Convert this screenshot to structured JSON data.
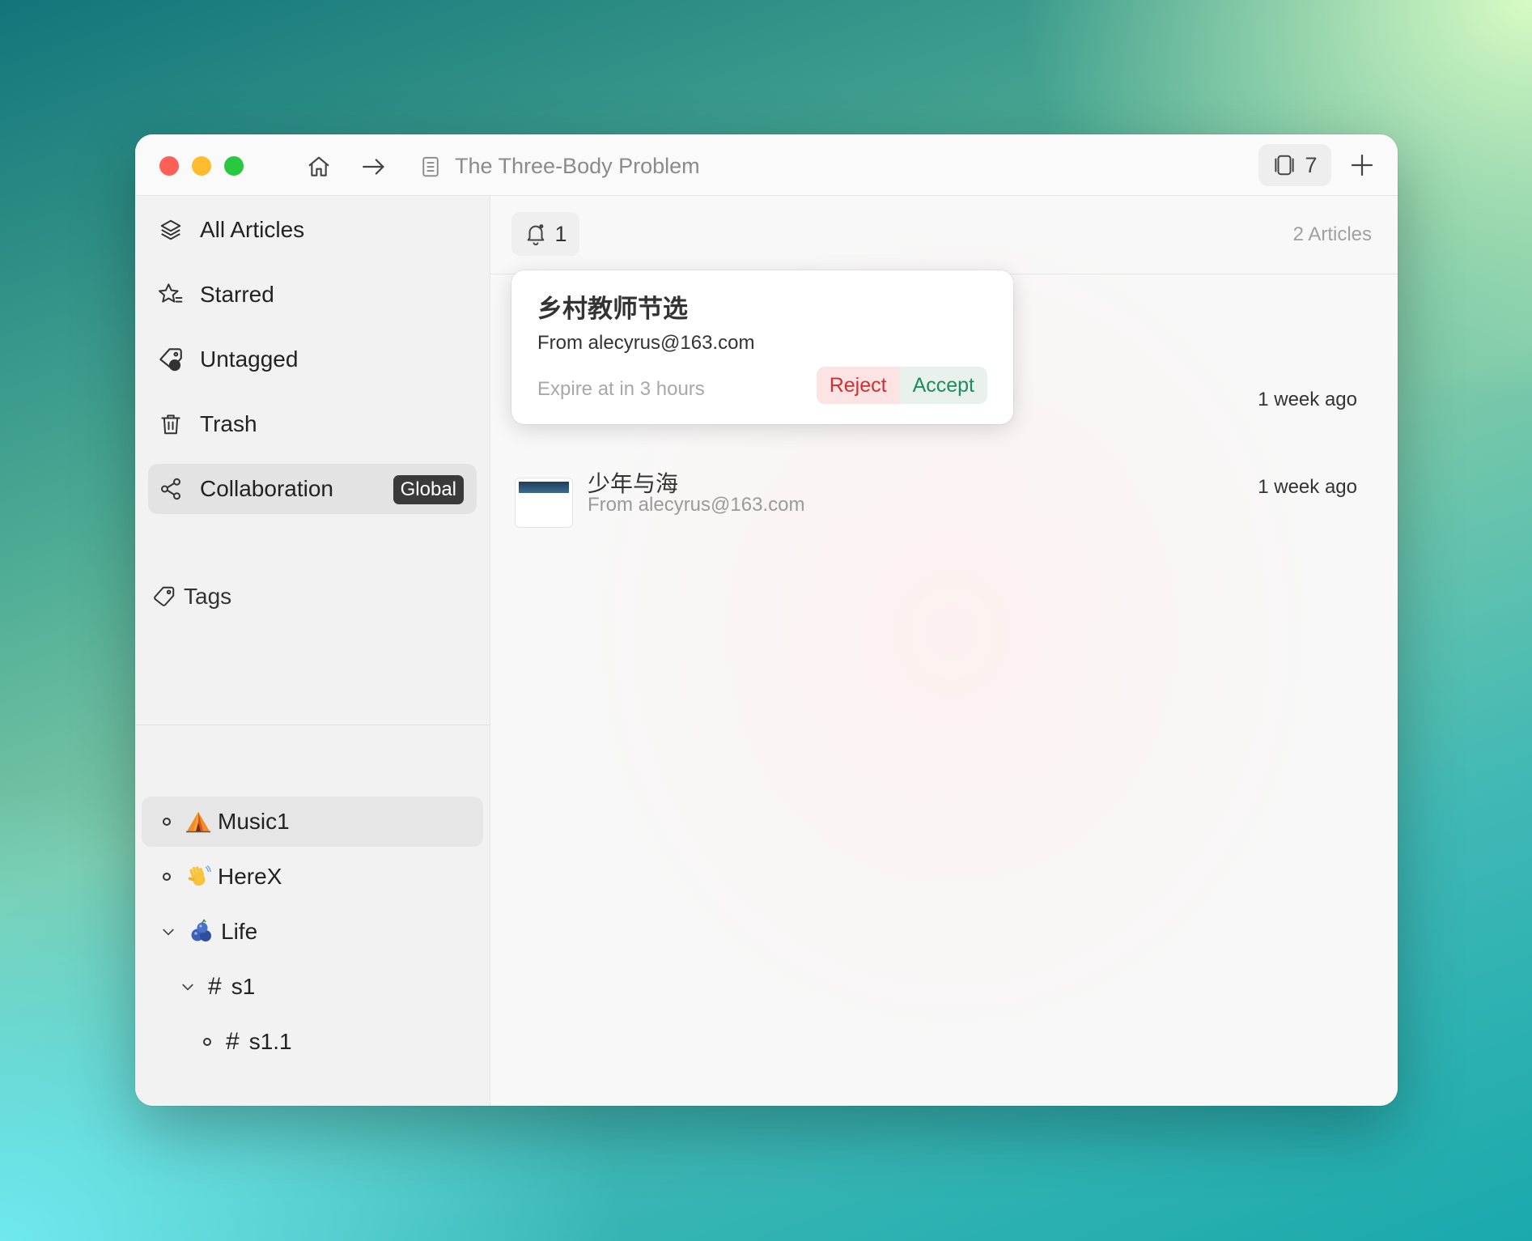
{
  "titlebar": {
    "title": "The Three-Body Problem",
    "tabs_count": "7"
  },
  "sidebar": {
    "nav": [
      {
        "label": "All Articles",
        "icon": "layers-icon"
      },
      {
        "label": "Starred",
        "icon": "star-list-icon"
      },
      {
        "label": "Untagged",
        "icon": "tag-question-icon"
      },
      {
        "label": "Trash",
        "icon": "trash-icon"
      },
      {
        "label": "Collaboration",
        "icon": "share-icon",
        "badge": "Global",
        "active": true
      }
    ],
    "tags_label": "Tags",
    "tags": [
      {
        "emoji": "⛺",
        "label": "Music1",
        "active": true
      },
      {
        "emoji": "👋",
        "label": "HereX"
      },
      {
        "emoji": "🫐",
        "label": "Life",
        "expanded": true
      },
      {
        "hash": "#",
        "label": "s1",
        "expanded": true
      },
      {
        "hash": "#",
        "label": "s1.1"
      }
    ]
  },
  "main": {
    "notification_count": "1",
    "articles_count": "2 Articles",
    "articles": [
      {
        "time": "1 week ago"
      },
      {
        "title": "少年与海",
        "from": "From alecyrus@163.com",
        "time": "1 week ago"
      }
    ]
  },
  "popover": {
    "title": "乡村教师节选",
    "from": "From alecyrus@163.com",
    "expire": "Expire at in 3 hours",
    "reject": "Reject",
    "accept": "Accept"
  },
  "colors": {
    "accent": "#1a73e8",
    "reject": "#d32f2f",
    "accept": "#1b8e5a"
  }
}
